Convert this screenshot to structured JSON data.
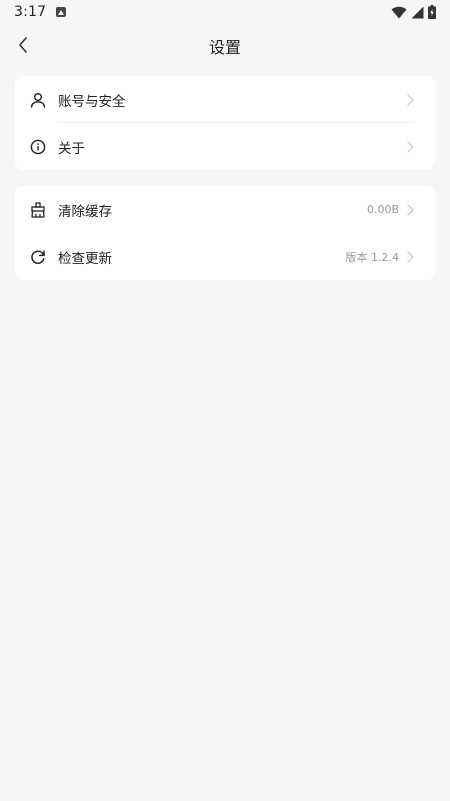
{
  "status_bar": {
    "time": "3:17",
    "icons": [
      "notification-a-icon",
      "wifi-icon",
      "signal-icon",
      "battery-charging-icon"
    ]
  },
  "header": {
    "title": "设置",
    "back_icon": "chevron-left-icon"
  },
  "groups": [
    {
      "items": [
        {
          "icon": "user-icon",
          "label": "账号与安全",
          "value": ""
        },
        {
          "icon": "info-icon",
          "label": "关于",
          "value": ""
        }
      ]
    },
    {
      "items": [
        {
          "icon": "broom-icon",
          "label": "清除缓存",
          "value": "0.00B"
        },
        {
          "icon": "refresh-icon",
          "label": "检查更新",
          "value": "版本 1.2.4"
        }
      ]
    }
  ],
  "colors": {
    "background": "#f6f6f6",
    "card": "#ffffff",
    "text": "#222222",
    "secondary_text": "#9a9a9a",
    "chevron": "#c4c4c4"
  }
}
